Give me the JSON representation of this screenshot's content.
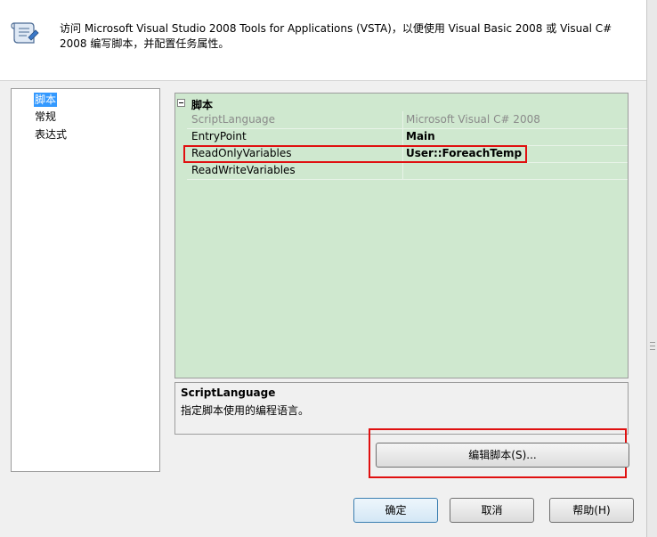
{
  "header": {
    "icon": "script-scroll-icon",
    "description": "访问 Microsoft Visual Studio 2008 Tools for Applications (VSTA)，以便使用 Visual Basic 2008 或 Visual C# 2008 编写脚本，并配置任务属性。"
  },
  "nav": {
    "items": [
      {
        "label": "脚本",
        "selected": true
      },
      {
        "label": "常规",
        "selected": false
      },
      {
        "label": "表达式",
        "selected": false
      }
    ]
  },
  "property_grid": {
    "category": "脚本",
    "rows": [
      {
        "name": "ScriptLanguage",
        "value": "Microsoft Visual C# 2008",
        "disabled": true
      },
      {
        "name": "EntryPoint",
        "value": "Main",
        "bold": true
      },
      {
        "name": "ReadOnlyVariables",
        "value": "User::ForeachTemp",
        "bold": true,
        "highlighted": true
      },
      {
        "name": "ReadWriteVariables",
        "value": ""
      }
    ],
    "background_color": "#cfe8cf"
  },
  "description": {
    "title": "ScriptLanguage",
    "text": "指定脚本使用的编程语言。"
  },
  "buttons": {
    "edit_script": "编辑脚本(S)...",
    "ok": "确定",
    "cancel": "取消",
    "help": "帮助(H)"
  },
  "annotation_color": "#e01010"
}
